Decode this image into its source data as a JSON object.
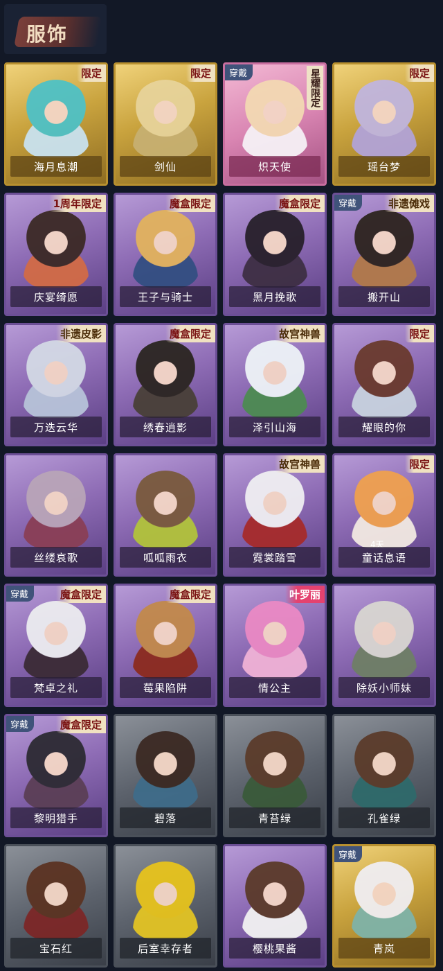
{
  "header": {
    "title": "服饰"
  },
  "cards": [
    {
      "name": "海月息潮",
      "badge": "限定",
      "tier": "gold",
      "worn": "",
      "hair": "#4fc1c6",
      "cloth": "#c9e2ef"
    },
    {
      "name": "剑仙",
      "badge": "限定",
      "tier": "gold",
      "worn": "",
      "hair": "#e7d39a",
      "cloth": "#c7b071"
    },
    {
      "name": "炽天使",
      "badge": "星耀限定",
      "tier": "pink",
      "worn": "穿戴",
      "hair": "#f3d9b3",
      "cloth": "#f6f1f6"
    },
    {
      "name": "瑶台梦",
      "badge": "限定",
      "tier": "gold",
      "worn": "",
      "hair": "#c0b5de",
      "cloth": "#b2a3d7"
    },
    {
      "name": "庆宴绮愿",
      "badge": "1周年限定",
      "tier": "purple",
      "worn": "",
      "hair": "#3b2a25",
      "cloth": "#d26b46"
    },
    {
      "name": "王子与骑士",
      "badge": "魔盒限定",
      "tier": "purple",
      "worn": "",
      "hair": "#e2b35d",
      "cloth": "#334f82"
    },
    {
      "name": "黑月挽歌",
      "badge": "魔盒限定",
      "tier": "purple",
      "worn": "",
      "hair": "#27202b",
      "cloth": "#3e2f44"
    },
    {
      "name": "搬开山",
      "badge": "非遗傩戏",
      "tier": "purple",
      "worn": "穿戴",
      "hair": "#2e241f",
      "cloth": "#b27a4a"
    },
    {
      "name": "万迭云华",
      "badge": "非遗皮影",
      "tier": "purple",
      "worn": "",
      "hair": "#d3d9e5",
      "cloth": "#b7c3d9"
    },
    {
      "name": "绣春逍影",
      "badge": "魔盒限定",
      "tier": "purple",
      "worn": "",
      "hair": "#2b2521",
      "cloth": "#494038"
    },
    {
      "name": "泽引山海",
      "badge": "故宫神兽",
      "tier": "purple",
      "worn": "",
      "hair": "#eef3f7",
      "cloth": "#4d8b52"
    },
    {
      "name": "耀眼的你",
      "badge": "限定",
      "tier": "purple",
      "worn": "",
      "hair": "#6a3a2e",
      "cloth": "#c8d2df"
    },
    {
      "name": "丝缕哀歌",
      "badge": "",
      "tier": "purple",
      "worn": "",
      "hair": "#b9a5b8",
      "cloth": "#8a3f56"
    },
    {
      "name": "呱呱雨衣",
      "badge": "",
      "tier": "purple",
      "worn": "",
      "hair": "#7a5a3d",
      "cloth": "#b2c33b"
    },
    {
      "name": "霓裳踏雪",
      "badge": "故宫神兽",
      "tier": "purple",
      "worn": "",
      "hair": "#f0eff2",
      "cloth": "#a62b2b"
    },
    {
      "name": "童话息语",
      "badge": "限定",
      "tier": "purple",
      "worn": "",
      "hair": "#f0a14f",
      "cloth": "#f2e9e2",
      "timer": "4天"
    },
    {
      "name": "梵卓之礼",
      "badge": "魔盒限定",
      "tier": "purple",
      "worn": "穿戴",
      "hair": "#ececf0",
      "cloth": "#3b2b36"
    },
    {
      "name": "莓果陷阱",
      "badge": "魔盒限定",
      "tier": "purple",
      "worn": "",
      "hair": "#c2894b",
      "cloth": "#8c2b1f"
    },
    {
      "name": "情公主",
      "badge": "叶罗丽",
      "tier": "purple",
      "worn": "",
      "hair": "#ea89c4",
      "cloth": "#f0b2d6"
    },
    {
      "name": "除妖小师妹",
      "badge": "",
      "tier": "purple",
      "worn": "",
      "hair": "#d9d6d1",
      "cloth": "#6f7f66"
    },
    {
      "name": "黎明猎手",
      "badge": "魔盒限定",
      "tier": "purple",
      "worn": "穿戴",
      "hair": "#2d2b33",
      "cloth": "#5b3f56"
    },
    {
      "name": "碧落",
      "badge": "",
      "tier": "gray",
      "worn": "",
      "hair": "#3b2a23",
      "cloth": "#3f6c8a"
    },
    {
      "name": "青苔绿",
      "badge": "",
      "tier": "gray",
      "worn": "",
      "hair": "#5b3c2b",
      "cloth": "#3a5a3a"
    },
    {
      "name": "孔雀绿",
      "badge": "",
      "tier": "gray",
      "worn": "",
      "hair": "#5b3c2b",
      "cloth": "#2f6a6b"
    },
    {
      "name": "宝石红",
      "badge": "",
      "tier": "gray",
      "worn": "",
      "hair": "#5b3322",
      "cloth": "#7c2727"
    },
    {
      "name": "后室幸存者",
      "badge": "",
      "tier": "gray",
      "worn": "",
      "hair": "#e7c31d",
      "cloth": "#e3c424"
    },
    {
      "name": "樱桃果酱",
      "badge": "",
      "tier": "purple",
      "worn": "",
      "hair": "#5b3a2a",
      "cloth": "#f2f2f2"
    },
    {
      "name": "青岚",
      "badge": "",
      "tier": "gold",
      "worn": "穿戴",
      "hair": "#f0eef2",
      "cloth": "#7fb3a8"
    }
  ]
}
